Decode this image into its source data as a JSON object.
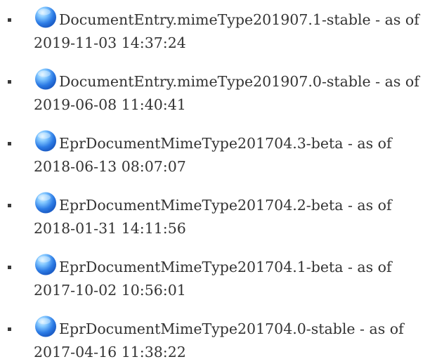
{
  "versions": [
    {
      "label": "DocumentEntry.mimeType201907.1-stable - as of",
      "timestamp": "2019-11-03 14:37:24",
      "icon": "globe-icon"
    },
    {
      "label": "DocumentEntry.mimeType201907.0-stable - as of",
      "timestamp": "2019-06-08 11:40:41",
      "icon": "globe-icon"
    },
    {
      "label": "EprDocumentMimeType201704.3-beta - as of",
      "timestamp": "2018-06-13 08:07:07",
      "icon": "globe-icon"
    },
    {
      "label": "EprDocumentMimeType201704.2-beta - as of",
      "timestamp": "2018-01-31 14:11:56",
      "icon": "globe-icon"
    },
    {
      "label": "EprDocumentMimeType201704.1-beta - as of",
      "timestamp": "2017-10-02 10:56:01",
      "icon": "globe-icon"
    },
    {
      "label": "EprDocumentMimeType201704.0-stable - as of",
      "timestamp": "2017-04-16 11:38:22",
      "icon": "globe-icon"
    }
  ],
  "colors": {
    "text": "#333333",
    "bullet": "#3a3a3a",
    "globe_light": "#bfe6ff",
    "globe_mid": "#4aa3f0",
    "globe_dark": "#1d5fc8"
  }
}
